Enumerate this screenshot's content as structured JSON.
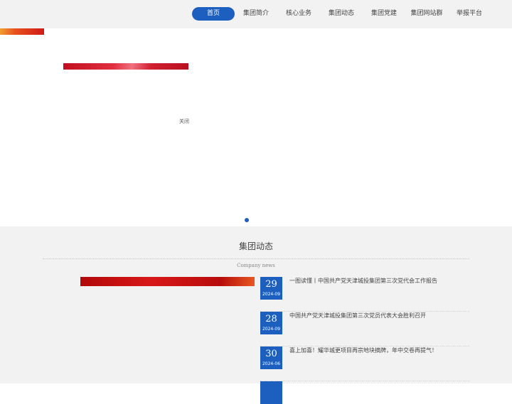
{
  "nav": {
    "items": [
      "首页",
      "集团简介",
      "核心业务",
      "集团动态",
      "集团党建",
      "集团网站群",
      "举报平台"
    ],
    "active_index": 0
  },
  "hero": {
    "close_label": "关闭",
    "slide_count": 1,
    "active_slide": 1
  },
  "news": {
    "title": "集团动态",
    "subtitle": "Company news",
    "items": [
      {
        "day": "29",
        "year_month": "2024-09",
        "title": "一图读懂丨中国共产党天津城投集团第三次党代会工作报告"
      },
      {
        "day": "28",
        "year_month": "2024-09",
        "title": "中国共产党天津城投集团第三次党员代表大会胜利召开"
      },
      {
        "day": "30",
        "year_month": "2024-06",
        "title": "喜上加喜！耀华城更项目再宗地块摘牌，年中交卷再提气！"
      },
      {
        "day": "",
        "year_month": "",
        "title": ""
      }
    ]
  },
  "colors": {
    "accent": "#1c5fbf",
    "header_bg": "#f2f2f2",
    "section_bg": "#f2f2f2",
    "banner_red": "#d01818"
  }
}
